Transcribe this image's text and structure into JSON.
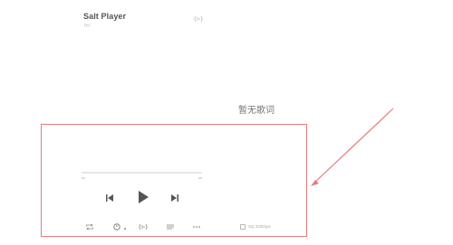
{
  "app": {
    "title": "Salt Player",
    "subtitle": "Hi~"
  },
  "lyrics": {
    "empty_text": "暂无歌词"
  },
  "player": {
    "controls": {
      "previous_icon": "skip-previous-icon",
      "play_icon": "play-icon",
      "next_icon": "skip-next-icon"
    },
    "bottom_bar": {
      "repeat_icon": "repeat-icon",
      "timer_icon": "timer-icon",
      "sound_effect_icon": "sound-effect-icon",
      "playlist_icon": "playlist-icon",
      "more_icon": "more-icon",
      "audio_format": "SQ 320kbps"
    }
  },
  "colors": {
    "annotation": "#e77a7a",
    "icon": "#555555",
    "muted_icon": "#8a8a8a"
  }
}
